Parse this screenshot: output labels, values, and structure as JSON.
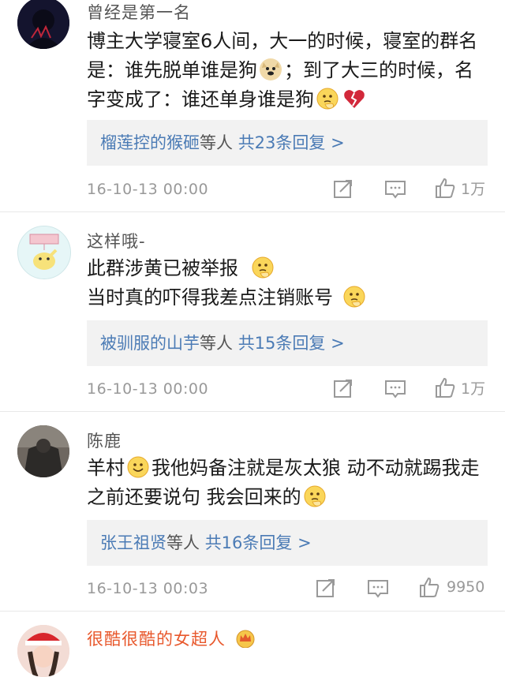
{
  "comments": [
    {
      "username": "曾经是第一名",
      "text_parts": [
        "博主大学寝室6人间，大一的时候，寝室的群名是：谁先脱单谁是狗",
        "；到了大三的时候，名字变成了：谁还单身谁是狗",
        ""
      ],
      "emojis": [
        "doge-emoji",
        "thinking-emoji",
        "broken-heart-emoji"
      ],
      "reply_names": "榴莲控的猴砸",
      "reply_suffix": "等人",
      "reply_count": "共23条回复 >",
      "timestamp": "16-10-13 00:00",
      "likes": "1万"
    },
    {
      "username": "这样哦-",
      "text_parts": [
        "此群涉黄已被举报",
        "当时真的吓得我差点注销账号",
        ""
      ],
      "emojis": [
        "thinking-emoji",
        "thinking-emoji"
      ],
      "reply_names": "被驯服的山芋",
      "reply_suffix": "等人",
      "reply_count": "共15条回复 >",
      "timestamp": "16-10-13 00:00",
      "likes": "1万"
    },
    {
      "username": "陈鹿",
      "text_parts": [
        "羊村",
        "我他妈备注就是灰太狼 动不动就踢我走之前还要说句 我会回来的",
        ""
      ],
      "emojis": [
        "smile-emoji",
        "thinking-emoji"
      ],
      "reply_names": "张王祖贤",
      "reply_suffix": "等人",
      "reply_count": "共16条回复 >",
      "timestamp": "16-10-13 00:03",
      "likes": "9950"
    },
    {
      "username": "很酷很酷的女超人",
      "badge": "crown-badge"
    }
  ],
  "colors": {
    "link": "#4b7bb5",
    "vip_name": "#e8582c",
    "meta": "#999999",
    "reply_bg": "#f2f2f2"
  }
}
